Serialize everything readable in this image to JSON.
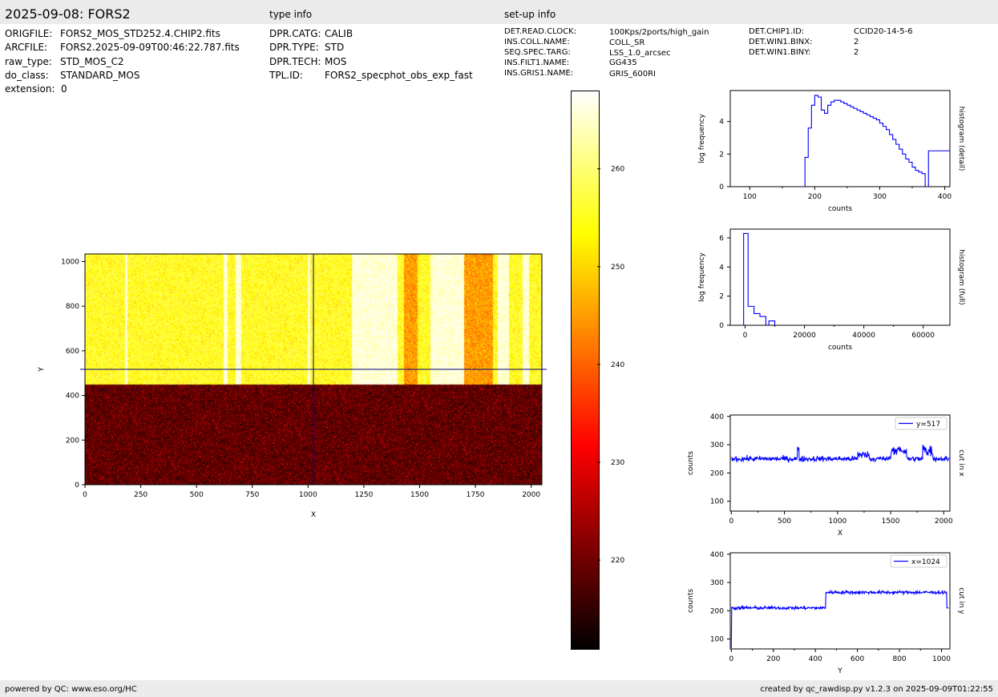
{
  "header": {
    "title": "2025-09-08: FORS2",
    "type_info_label": "type info",
    "setup_info_label": "set-up info"
  },
  "file_info": [
    {
      "key": "ORIGFILE:",
      "value": "FORS2_MOS_STD252.4.CHIP2.fits"
    },
    {
      "key": "ARCFILE:",
      "value": "FORS2.2025-09-09T00:46:22.787.fits"
    },
    {
      "key": "raw_type:",
      "value": "STD_MOS_C2"
    },
    {
      "key": "do_class:",
      "value": "STANDARD_MOS"
    },
    {
      "key": "extension:",
      "value": "0"
    }
  ],
  "type_info": [
    {
      "key": "DPR.CATG:",
      "value": "CALIB"
    },
    {
      "key": "DPR.TYPE:",
      "value": "STD"
    },
    {
      "key": "DPR.TECH:",
      "value": "MOS"
    },
    {
      "key": "TPL.ID:",
      "value": "FORS2_specphot_obs_exp_fast"
    }
  ],
  "setup_info": [
    {
      "key": "DET.READ.CLOCK:",
      "value": "100Kps/2ports/high_gain"
    },
    {
      "key": "INS.COLL.NAME:",
      "value": "COLL_SR"
    },
    {
      "key": "SEQ.SPEC.TARG:",
      "value": "LSS_1.0_arcsec"
    },
    {
      "key": "INS.FILT1.NAME:",
      "value": "GG435"
    },
    {
      "key": "INS.GRIS1.NAME:",
      "value": "GRIS_600RI"
    }
  ],
  "setup_info2": [
    {
      "key": "DET.CHIP1.ID:",
      "value": "CCID20-14-5-6"
    },
    {
      "key": "DET.WIN1.BINX:",
      "value": "2"
    },
    {
      "key": "DET.WIN1.BINY:",
      "value": "2"
    }
  ],
  "footer": {
    "left": "powered by QC: www.eso.org/HC",
    "right": "created by qc_rawdisp.py v1.2.3 on 2025-09-09T01:22:55"
  },
  "colors": {
    "bar_bg": "#ebebeb",
    "line": "#0000ff",
    "cut_line": "#000080"
  },
  "chart_data": [
    {
      "type": "heatmap",
      "colormap": "hot",
      "xlabel": "X",
      "ylabel": "Y",
      "xlim": [
        0,
        2048
      ],
      "ylim": [
        0,
        1034
      ],
      "xticks": [
        0,
        250,
        500,
        750,
        1000,
        1250,
        1500,
        1750,
        2000
      ],
      "yticks": [
        0,
        200,
        400,
        600,
        800,
        1000
      ],
      "cut_x": 1024,
      "cut_y": 517,
      "bright_region_y": [
        450,
        1034
      ],
      "bright_columns": [
        [
          180,
          190
        ],
        [
          620,
          640
        ],
        [
          675,
          700
        ],
        [
          1000,
          1010
        ],
        [
          1195,
          1400
        ],
        [
          1550,
          1700
        ],
        [
          1850,
          1900
        ],
        [
          1960,
          1990
        ]
      ],
      "dark_columns": [
        [
          1430,
          1490
        ],
        [
          1700,
          1830
        ]
      ]
    },
    {
      "type": "colorbar",
      "vmin": 211,
      "vmax": 268,
      "ticks": [
        220,
        230,
        240,
        250,
        260
      ]
    },
    {
      "type": "line",
      "title": "histogram (detail)",
      "xlabel": "counts",
      "ylabel": "log frequency",
      "xlim": [
        70,
        408
      ],
      "ylim": [
        0,
        5.9
      ],
      "xticks": [
        100,
        200,
        300,
        400
      ],
      "yticks": [
        0,
        2,
        4
      ],
      "step": true,
      "x": [
        70,
        180,
        185,
        190,
        195,
        200,
        205,
        210,
        215,
        220,
        225,
        230,
        235,
        240,
        245,
        250,
        255,
        260,
        265,
        270,
        275,
        280,
        285,
        290,
        295,
        300,
        305,
        310,
        315,
        320,
        325,
        330,
        335,
        340,
        345,
        350,
        355,
        360,
        365,
        370,
        375,
        380,
        385,
        390,
        395,
        400,
        405
      ],
      "y": [
        0,
        0,
        1.8,
        3.6,
        5.0,
        5.6,
        5.5,
        4.7,
        4.5,
        5.0,
        5.2,
        5.3,
        5.3,
        5.2,
        5.1,
        5.0,
        4.9,
        4.8,
        4.7,
        4.6,
        4.5,
        4.4,
        4.3,
        4.2,
        4.1,
        3.9,
        3.7,
        3.5,
        3.2,
        2.9,
        2.6,
        2.3,
        2.0,
        1.7,
        1.5,
        1.2,
        1.0,
        0.9,
        0.8,
        0,
        2.2,
        2.2,
        2.2,
        2.2,
        2.2,
        2.2,
        2.2
      ]
    },
    {
      "type": "line",
      "title": "histogram (full)",
      "xlabel": "counts",
      "ylabel": "log frequency",
      "xlim": [
        -5000,
        69000
      ],
      "ylim": [
        0,
        6.6
      ],
      "xticks": [
        0,
        20000,
        40000,
        60000
      ],
      "yticks": [
        0,
        2,
        4,
        6
      ],
      "step": true,
      "x": [
        -5000,
        -1500,
        -500,
        1000,
        2000,
        3000,
        4000,
        5000,
        6000,
        7000,
        8000,
        9000,
        10000,
        69000
      ],
      "y": [
        0,
        0,
        6.3,
        1.3,
        1.3,
        0.8,
        0.8,
        0.6,
        0.6,
        0,
        0.3,
        0.3,
        0,
        0
      ]
    },
    {
      "type": "line",
      "legend": "y=517",
      "title": "cut in x",
      "xlabel": "X",
      "ylabel": "counts",
      "xlim": [
        -10,
        2058
      ],
      "ylim": [
        65,
        405
      ],
      "xticks": [
        0,
        500,
        1000,
        1500,
        2000
      ],
      "yticks": [
        100,
        200,
        300,
        400
      ],
      "base": 250,
      "noise": 12
    },
    {
      "type": "line",
      "legend": "x=1024",
      "title": "cut in y",
      "xlabel": "Y",
      "ylabel": "counts",
      "xlim": [
        -5,
        1040
      ],
      "ylim": [
        65,
        405
      ],
      "xticks": [
        0,
        200,
        400,
        600,
        800,
        1000
      ],
      "yticks": [
        100,
        200,
        300,
        400
      ],
      "base_low": 210,
      "base_high": 265,
      "step_at": 450,
      "noise": 10
    }
  ]
}
